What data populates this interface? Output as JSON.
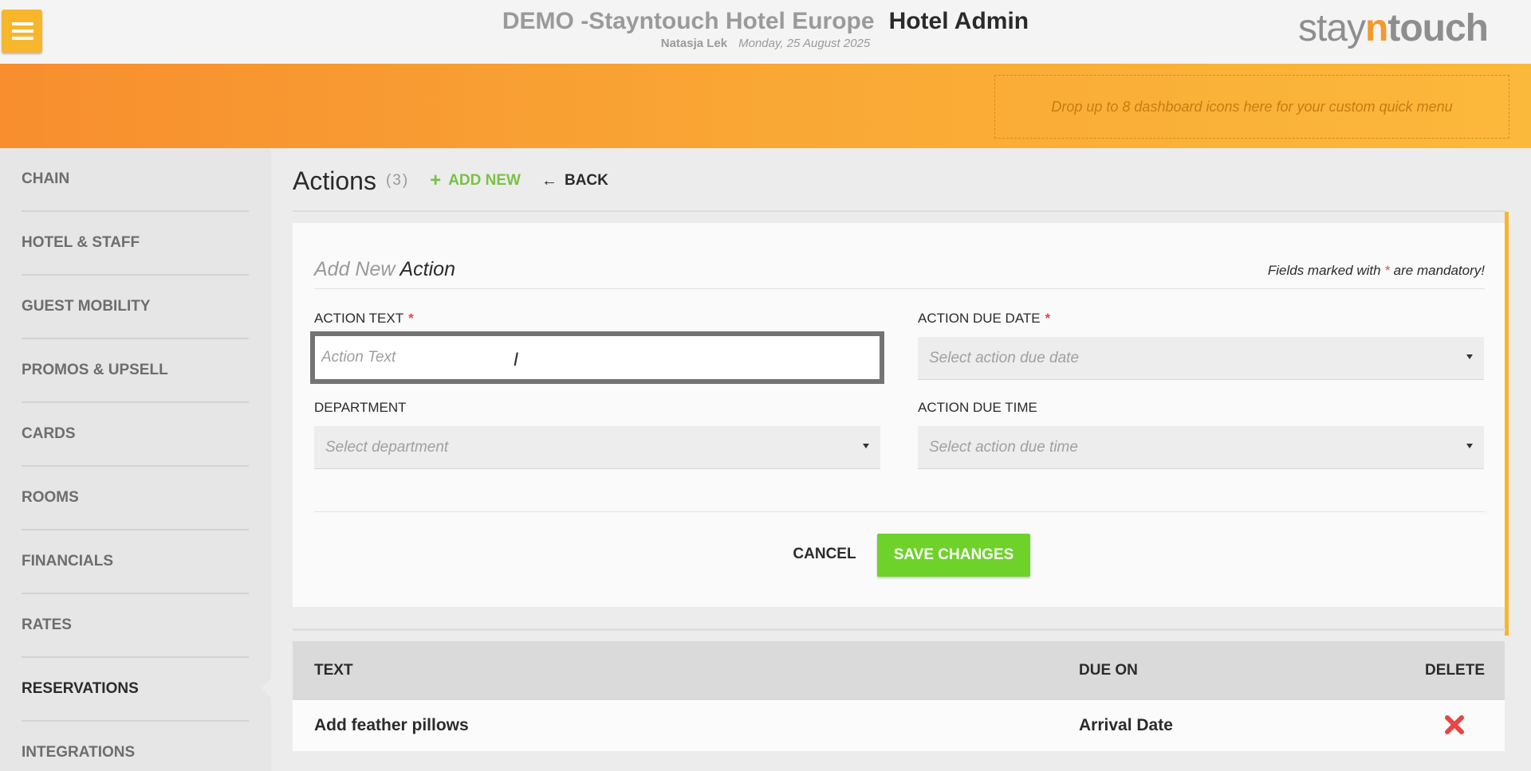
{
  "header": {
    "hotel_name": "DEMO -Stayntouch Hotel Europe",
    "app_name": "Hotel Admin",
    "user": "Natasja Lek",
    "date": "Monday, 25 August 2025",
    "logo_part1": "stay",
    "logo_part2": "n",
    "logo_part3": "touch",
    "menu_icon": "hamburger-icon"
  },
  "quick_menu": {
    "placeholder": "Drop up to 8 dashboard icons here for your custom quick menu"
  },
  "sidebar": {
    "items": [
      {
        "label": "CHAIN"
      },
      {
        "label": "HOTEL & STAFF"
      },
      {
        "label": "GUEST MOBILITY"
      },
      {
        "label": "PROMOS & UPSELL"
      },
      {
        "label": "CARDS"
      },
      {
        "label": "ROOMS"
      },
      {
        "label": "FINANCIALS"
      },
      {
        "label": "RATES"
      },
      {
        "label": "RESERVATIONS"
      },
      {
        "label": "INTEGRATIONS"
      }
    ],
    "active": "RESERVATIONS"
  },
  "page": {
    "title": "Actions",
    "count": "(3)",
    "add_new_label": "ADD NEW",
    "back_label": "BACK"
  },
  "form": {
    "title_prefix": "Add New",
    "title_main": "Action",
    "mandatory_pre": "Fields marked with",
    "mandatory_star": "*",
    "mandatory_post": "are mandatory!",
    "action_text_label": "ACTION TEXT",
    "action_text_placeholder": "Action Text",
    "action_text_value": "",
    "due_date_label": "ACTION DUE DATE",
    "due_date_placeholder": "Select action due date",
    "department_label": "DEPARTMENT",
    "department_placeholder": "Select department",
    "due_time_label": "ACTION DUE TIME",
    "due_time_placeholder": "Select action due time",
    "required_mark": "*",
    "cancel_label": "CANCEL",
    "save_label": "SAVE CHANGES"
  },
  "table": {
    "columns": [
      "TEXT",
      "DUE ON",
      "DELETE"
    ],
    "rows": [
      {
        "text": "Add feather pillows",
        "due_on": "Arrival Date",
        "delete_icon": "delete-x-icon"
      }
    ]
  },
  "colors": {
    "accent_orange": "#f9a735",
    "save_green": "#6ed22a",
    "add_new_green": "#7ac143",
    "delete_red": "#e84545"
  }
}
